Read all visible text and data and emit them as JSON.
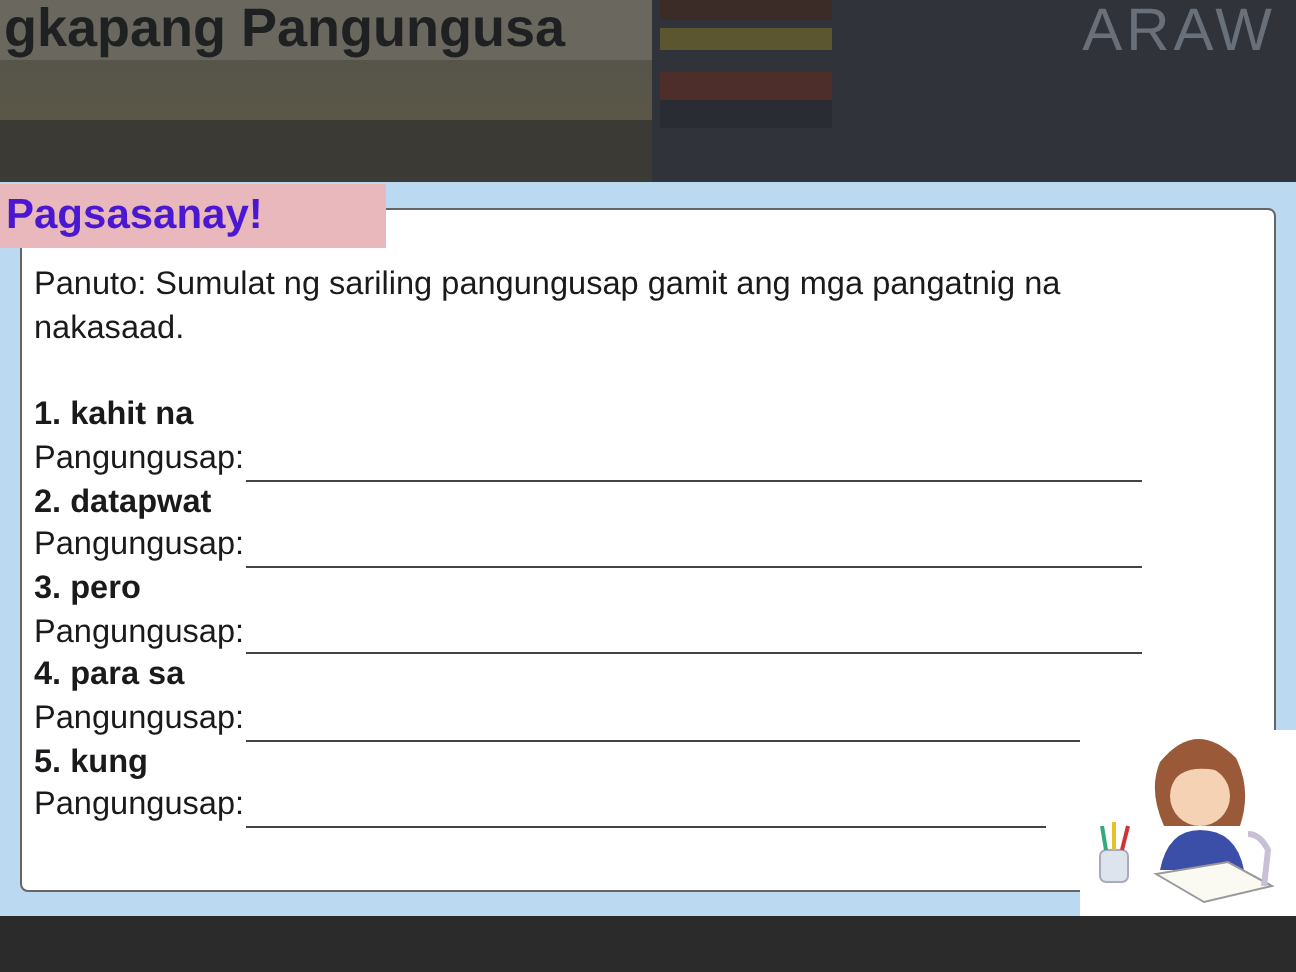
{
  "background_slide": {
    "title": "gkapang Pangungusa",
    "heading_right": "ARAW"
  },
  "exercise": {
    "title": "Pagsasanay!",
    "instructions": "Panuto: Sumulat ng sariling pangungusap gamit ang mga pangatnig na nakasaad.",
    "items": [
      {
        "heading": "1. kahit na",
        "answer_label": "Pangungusap:"
      },
      {
        "heading": "2. datapwat",
        "answer_label": "Pangungusap:"
      },
      {
        "heading": "3. pero",
        "answer_label": "Pangungusap:"
      },
      {
        "heading": "4. para sa",
        "answer_label": "Pangungusap:"
      },
      {
        "heading": "5. kung",
        "answer_label": "Pangungusap:"
      }
    ]
  }
}
